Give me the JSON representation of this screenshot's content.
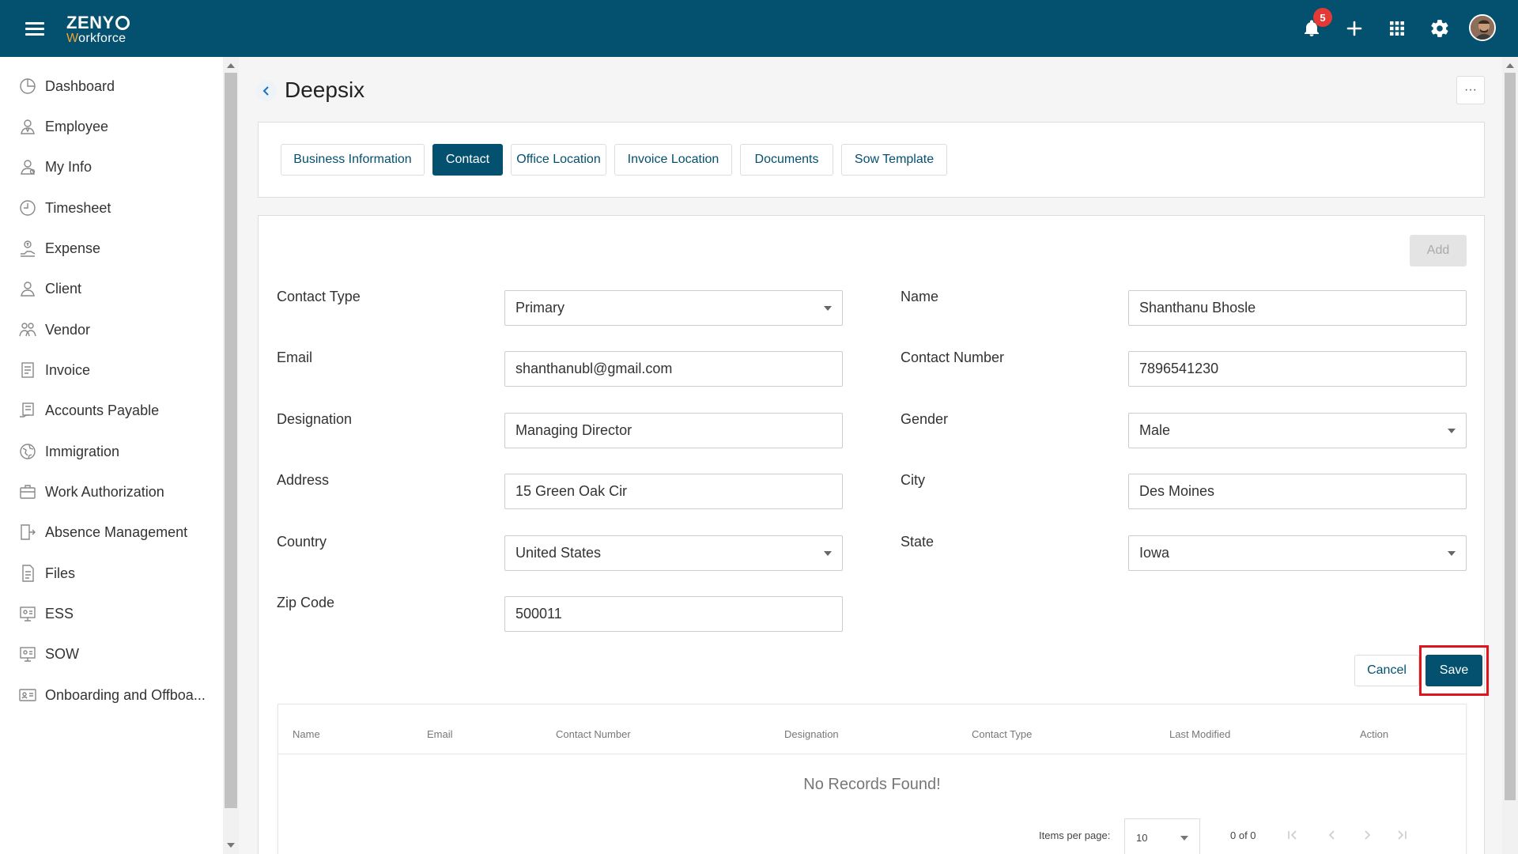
{
  "header": {
    "logo_line1": "ZENY",
    "logo_line2_w": "W",
    "logo_line2_rest": "orkforce",
    "notification_count": "5"
  },
  "sidebar": {
    "items": [
      {
        "label": "Dashboard",
        "icon": "dashboard-icon"
      },
      {
        "label": "Employee",
        "icon": "employee-icon"
      },
      {
        "label": "My Info",
        "icon": "my-info-icon"
      },
      {
        "label": "Timesheet",
        "icon": "clock-icon"
      },
      {
        "label": "Expense",
        "icon": "expense-icon"
      },
      {
        "label": "Client",
        "icon": "user-icon"
      },
      {
        "label": "Vendor",
        "icon": "vendor-icon"
      },
      {
        "label": "Invoice",
        "icon": "invoice-icon"
      },
      {
        "label": "Accounts Payable",
        "icon": "accounts-payable-icon"
      },
      {
        "label": "Immigration",
        "icon": "globe-icon"
      },
      {
        "label": "Work Authorization",
        "icon": "briefcase-icon"
      },
      {
        "label": "Absence Management",
        "icon": "exit-door-icon"
      },
      {
        "label": "Files",
        "icon": "file-icon"
      },
      {
        "label": "ESS",
        "icon": "ess-icon"
      },
      {
        "label": "SOW",
        "icon": "sow-icon"
      },
      {
        "label": "Onboarding and Offboa...",
        "icon": "id-card-icon"
      }
    ]
  },
  "page": {
    "title": "Deepsix",
    "more_label": "···"
  },
  "tabs": [
    {
      "label": "Business Information",
      "active": false
    },
    {
      "label": "Contact",
      "active": true
    },
    {
      "label": "Office Location",
      "active": false
    },
    {
      "label": "Invoice Location",
      "active": false
    },
    {
      "label": "Documents",
      "active": false
    },
    {
      "label": "Sow Template",
      "active": false
    }
  ],
  "form": {
    "add_label": "Add",
    "contact_type": {
      "label": "Contact Type",
      "value": "Primary"
    },
    "name": {
      "label": "Name",
      "value": "Shanthanu Bhosle"
    },
    "email": {
      "label": "Email",
      "value": "shanthanubl@gmail.com"
    },
    "contact_number": {
      "label": "Contact Number",
      "value": "7896541230"
    },
    "designation": {
      "label": "Designation",
      "value": "Managing Director"
    },
    "gender": {
      "label": "Gender",
      "value": "Male"
    },
    "address": {
      "label": "Address",
      "value": "15 Green Oak Cir"
    },
    "city": {
      "label": "City",
      "value": "Des Moines"
    },
    "country": {
      "label": "Country",
      "value": "United States"
    },
    "state": {
      "label": "State",
      "value": "Iowa"
    },
    "zip": {
      "label": "Zip Code",
      "value": "500011"
    },
    "cancel_label": "Cancel",
    "save_label": "Save"
  },
  "table": {
    "columns": [
      "Name",
      "Email",
      "Contact Number",
      "Designation",
      "Contact Type",
      "Last Modified",
      "Action"
    ],
    "empty_message": "No Records Found!",
    "items_per_page_label": "Items per page:",
    "items_per_page_value": "10",
    "range_label": "0 of 0"
  },
  "colors": {
    "primary": "#04506f",
    "highlight": "#e0141c",
    "badge": "#e53935"
  }
}
